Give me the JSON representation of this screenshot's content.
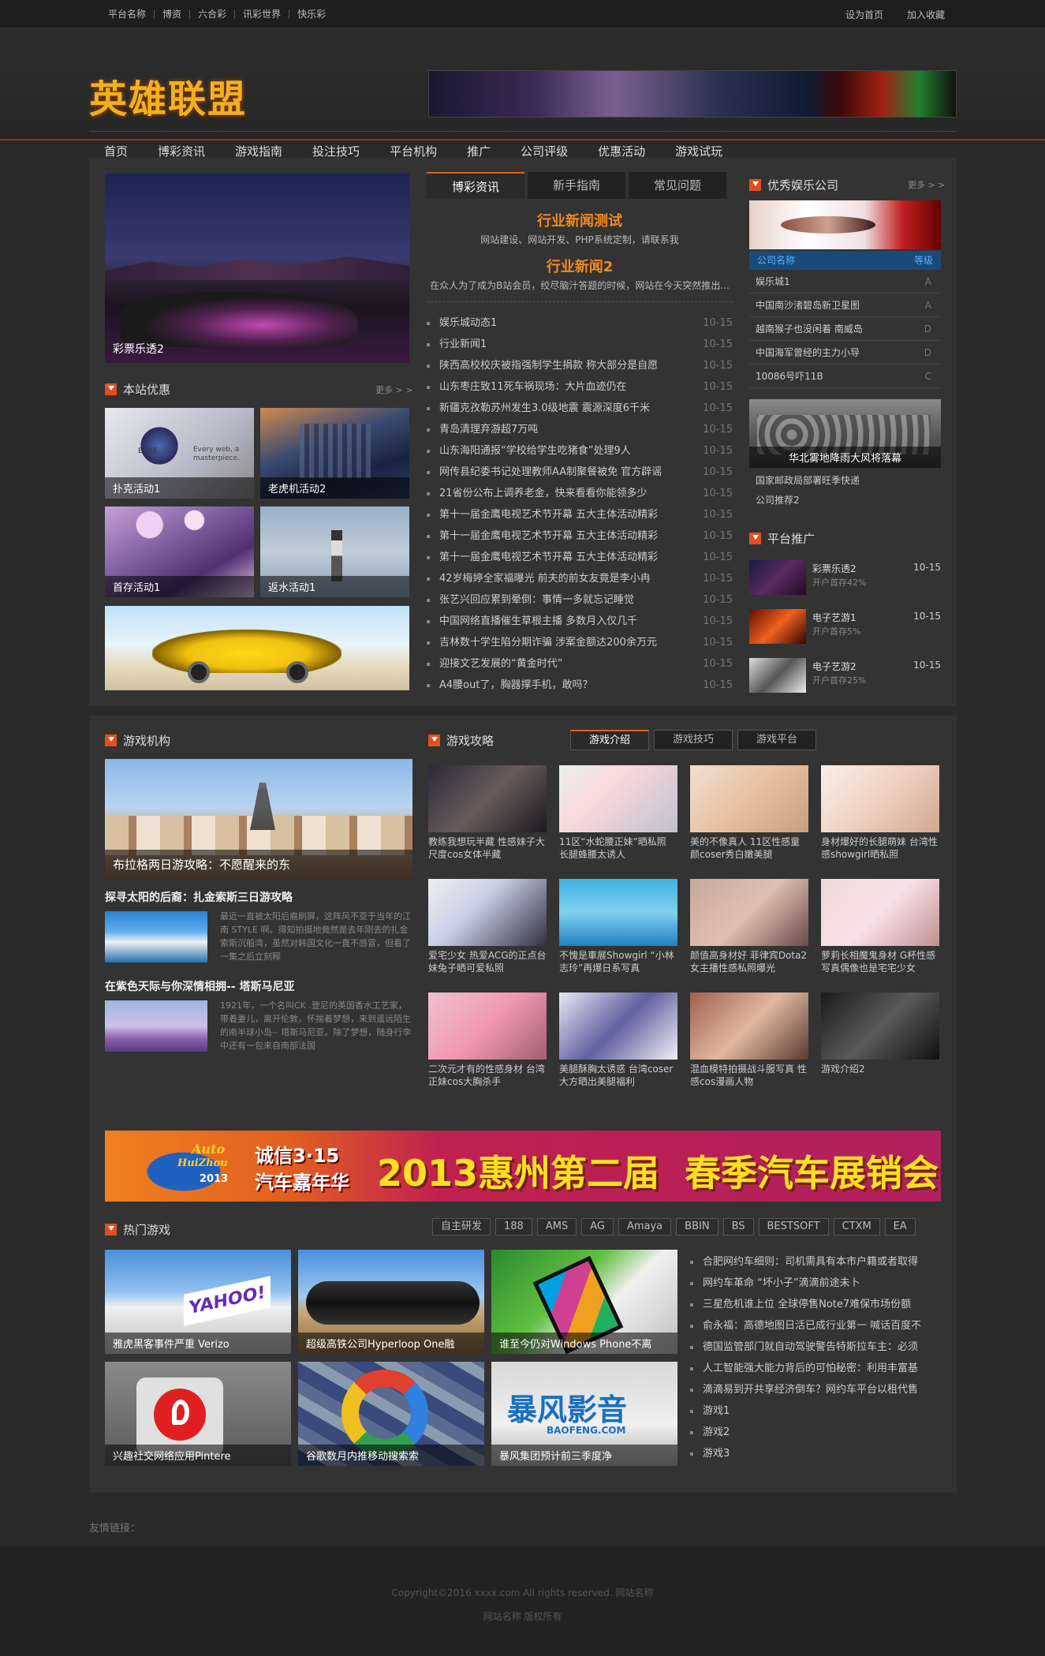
{
  "topbar": {
    "links": [
      "平台名称",
      "博资",
      "六合彩",
      "讯彩世界",
      "快乐彩"
    ],
    "right": [
      "设为首页",
      "加入收藏"
    ]
  },
  "logo": "英雄联盟",
  "nav": [
    "首页",
    "博彩资讯",
    "游戏指南",
    "投注技巧",
    "平台机构",
    "推广",
    "公司评级",
    "优惠活动",
    "游戏试玩"
  ],
  "left": {
    "hero_caption": "彩票乐透2",
    "promo_title": "本站优惠",
    "more": "更多 > >",
    "promos": [
      "扑克活动1",
      "老虎机活动2",
      "首存活动1",
      "返水活动1"
    ],
    "promo_overlay_a": "ELISE",
    "promo_overlay_b": "Every web, a masterpiece."
  },
  "center": {
    "tabs": [
      "博彩资讯",
      "新手指南",
      "常见问题"
    ],
    "headline1": "行业新闻测试",
    "headline1_sub": "网站建设、网站开发、PHP系统定制，请联系我",
    "headline2": "行业新闻2",
    "headline2_sub": "在众人为了成为B站会员，绞尽脑汁答题的时候，网站在今天突然推出...",
    "date": "10-15",
    "news": [
      "娱乐城动态1",
      "行业新闻1",
      "陕西高校校庆被指强制学生捐款 称大部分是自愿",
      "山东枣庄致11死车祸现场：大片血迹仍在",
      "新疆克孜勒苏州发生3.0级地震 震源深度6千米",
      "青岛清理弃游超7万吨",
      "山东海阳通报“学校给学生吃猪食”处理9人",
      "网传县纪委书记处理教师AA制聚餐被免 官方辟谣",
      "21省份公布上调养老金，快来看看你能领多少",
      "第十一届金鹰电视艺术节开幕 五大主体活动精彩",
      "第十一届金鹰电视艺术节开幕 五大主体活动精彩",
      "第十一届金鹰电视艺术节开幕 五大主体活动精彩",
      "42岁梅婷全家福曝光 前夫的前女友竟是李小冉",
      "张艺兴回应累到晕倒：事情一多就忘记睡觉",
      "中国网络直播催生草根主播 多数月入仅几千",
      "吉林数十学生陷分期诈骗 涉案金额达200余万元",
      "迎接文艺发展的“黄金时代”",
      "A4腰out了，胸器撑手机，敢吗？"
    ]
  },
  "right": {
    "corp_title": "优秀娱乐公司",
    "more": "更多 > >",
    "corp_header": [
      "公司名称",
      "等级"
    ],
    "corps": [
      {
        "name": "娱乐城1",
        "grade": "A"
      },
      {
        "name": "中国南沙渚碧岛新卫星图",
        "grade": "A"
      },
      {
        "name": "越南猴子也没闲着 南威岛",
        "grade": "D"
      },
      {
        "name": "中国海军曾经的主力小导",
        "grade": "D"
      },
      {
        "name": "10086号吓11B",
        "grade": "C"
      }
    ],
    "photo_caption": "华北雾地降雨大风将落幕",
    "links": [
      "国家邮政局部署旺季快递",
      "公司推荐2"
    ],
    "promote_title": "平台推广",
    "promotes": [
      {
        "title": "彩票乐透2",
        "sub": "开户首存42%",
        "date": "10-15"
      },
      {
        "title": "电子艺游1",
        "sub": "开户首存5%",
        "date": "10-15"
      },
      {
        "title": "电子艺游2",
        "sub": "开户首存25%",
        "date": "10-15"
      }
    ]
  },
  "org": {
    "title": "游戏机构",
    "hero_caption": "布拉格两日游攻略：不愿醒来的东",
    "articles": [
      {
        "title": "探寻太阳的后裔：扎金索斯三日游攻略",
        "desc": "最近一直被太阳后裔刷屏，这阵风不亚于当年的江南 STYLE 啊。得知拍摄地竟然是去年刚去的扎金索斯沉船湾，虽然对韩国文化一直不感冒，但看了一集之后立刻释"
      },
      {
        "title": "在紫色天际与你深情相拥-- 塔斯马尼亚",
        "desc": "1921年，一个名叫CK .登尼的英国香水工艺家，带着妻儿，离开伦敦，怀揣着梦想，来到遥远陌生的南半球小岛-- 塔斯马尼亚。除了梦想，随身行李中还有一包来自南部法国"
      }
    ]
  },
  "guide": {
    "title": "游戏攻略",
    "tabs": [
      "游戏介绍",
      "游戏技巧",
      "游戏平台"
    ],
    "items": [
      "教练我想玩半藏 性感妹子大尺度cos女体半藏",
      "11区“水蛇腰正妹”晒私照 长腿蜂腰太诱人",
      "美的不像真人 11区性感童颜coser秀白嫩美腿",
      "身材爆好的长腿萌妹 台湾性感showgirl晒私照",
      "爱宅少女 热爱ACG的正点台妹兔子晒可爱私照",
      "不愧是車展Showgirl “小林志玲”再爆日系写真",
      "颜值高身材好 菲律宾Dota2女主播性感私照曝光",
      "萝莉长相魔鬼身材 G杯性感写真偶像也是宅宅少女",
      "二次元才有的性感身材 台湾正妹cos大胸杀手",
      "美腿酥胸太诱惑 台湾coser大方晒出美腿福利",
      "混血模特拍摄战斗服写真 性感cos漫画人物",
      "游戏介绍2"
    ]
  },
  "ad": {
    "auto": "Auto",
    "huizhou": "HuiZhou",
    "year": "2013",
    "slogan1": "诚信3·15",
    "slogan2": "汽车嘉年华",
    "main": "2013惠州第二届  春季汽车展销会"
  },
  "hot": {
    "title": "热门游戏",
    "tags": [
      "自主研发",
      "188",
      "AMS",
      "AG",
      "Amaya",
      "BBIN",
      "BS",
      "BESTSOFT",
      "CTXM",
      "EA"
    ],
    "captions": [
      "雅虎黑客事件严重 Verizo",
      "超级高铁公司Hyperloop One融",
      "谁至今仍对Windows Phone不离",
      "兴趣社交网络应用Pintere",
      "谷歌数月内推移动搜索索",
      "暴风集团预计前三季度净"
    ],
    "thumb_text": [
      "YAHOO!",
      "暴风影音",
      "BAOFENG.COM"
    ],
    "news": [
      "合肥网约车细则：司机需具有本市户籍或者取得",
      "网约车革命 “坏小子”滴滴前途未卜",
      "三星危机谁上位 全球停售Note7难保市场份额",
      "俞永福：高德地图日活已成行业第一 喊话百度不",
      "德国监管部门就自动驾驶警告特斯拉车主：必须",
      "人工智能强大能力背后的可怕秘密：利用丰富基",
      "滴滴易到开共享经济倒车？网约车平台以租代售",
      "游戏1",
      "游戏2",
      "游戏3"
    ]
  },
  "footer": {
    "links_label": "友情链接：",
    "copyright": "Copyright©2016 xxxx.com All rights reserved. 网站名称",
    "brand": "网站名称 版权所有"
  }
}
